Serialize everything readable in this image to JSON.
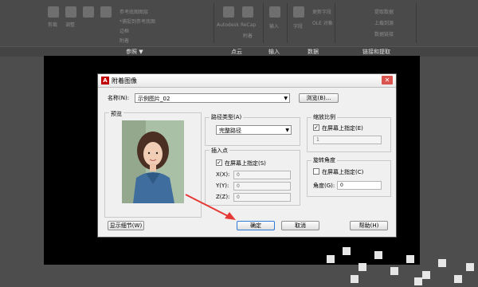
{
  "ribbon": {
    "groups": [
      "参照 ▼",
      "点云",
      "输入",
      "数据",
      "链接和提取"
    ],
    "faded_items": [
      "剪裁",
      "调整",
      "参考底图图层",
      "*捕捉到参考底图",
      "边框",
      "附着",
      "Autodesk ReCap",
      "附着",
      "输入",
      "字段",
      "更新字段",
      "OLE 对象",
      "提取数据",
      "上载到源",
      "数据链接"
    ]
  },
  "dialog": {
    "title": "附着图像",
    "name_label": "名称(N):",
    "name_value": "示例图片_02",
    "browse_button": "浏览(B)...",
    "preview_label": "预览",
    "path_type_label": "路径类型(A)",
    "path_type_value": "完整路径",
    "insertion_point_label": "插入点",
    "insertion_specify_label": "在屏幕上指定(S)",
    "insertion_specify_checked": true,
    "x_label": "X(X):",
    "y_label": "Y(Y):",
    "z_label": "Z(Z):",
    "x_value": "0",
    "y_value": "0",
    "z_value": "0",
    "scale_label": "缩放比例",
    "scale_specify_label": "在屏幕上指定(E)",
    "scale_specify_checked": true,
    "scale_value": "1",
    "rotation_label": "旋转角度",
    "rotation_specify_label": "在屏幕上指定(C)",
    "rotation_specify_checked": false,
    "angle_label": "角度(G):",
    "angle_value": "0",
    "show_details_button": "显示细节(W)",
    "ok_button": "确定",
    "cancel_button": "取消",
    "help_button": "帮助(H)"
  },
  "colors": {
    "accent": "#e53935",
    "ok_border": "#2b7bd6",
    "title_logo": "#c00000"
  }
}
